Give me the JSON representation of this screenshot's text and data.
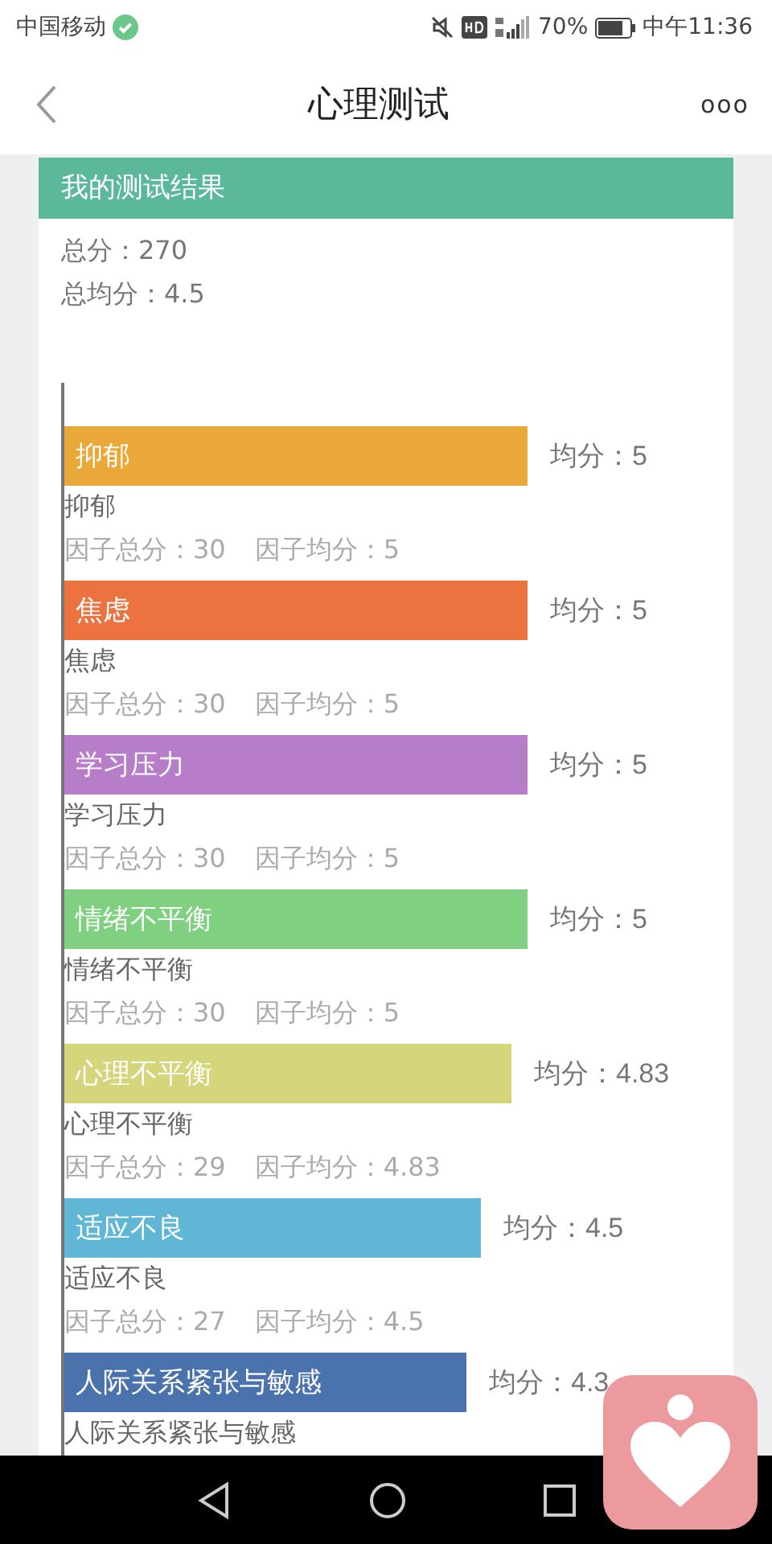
{
  "status_bar": {
    "carrier": "中国移动",
    "battery": "70%",
    "time": "中午11:36"
  },
  "header": {
    "title": "心理测试",
    "more": "ooo"
  },
  "card": {
    "title": "我的测试结果",
    "total": "总分：270",
    "average": "总均分：4.5",
    "factors": [
      {
        "label": "抑郁",
        "color": "#eaa838",
        "avg": "均分：5",
        "name": "抑郁",
        "factor_total": "因子总分：30",
        "factor_avg": "因子均分：5"
      },
      {
        "label": "焦虑",
        "color": "#ec7340",
        "avg": "均分：5",
        "name": "焦虑",
        "factor_total": "因子总分：30",
        "factor_avg": "因子均分：5"
      },
      {
        "label": "学习压力",
        "color": "#b77dc8",
        "avg": "均分：5",
        "name": "学习压力",
        "factor_total": "因子总分：30",
        "factor_avg": "因子均分：5"
      },
      {
        "label": "情绪不平衡",
        "color": "#80d081",
        "avg": "均分：5",
        "name": "情绪不平衡",
        "factor_total": "因子总分：30",
        "factor_avg": "因子均分：5"
      },
      {
        "label": "心理不平衡",
        "color": "#d5d57b",
        "avg": "均分：4.83",
        "name": "心理不平衡",
        "factor_total": "因子总分：29",
        "factor_avg": "因子均分：4.83"
      },
      {
        "label": "适应不良",
        "color": "#5fb7d5",
        "avg": "均分：4.5",
        "name": "适应不良",
        "factor_total": "因子总分：27",
        "factor_avg": "因子均分：4.5"
      },
      {
        "label": "人际关系紧张与敏感",
        "color": "#4a73ae",
        "avg": "均分：4.3",
        "name": "人际关系紧张与敏感"
      }
    ]
  }
}
